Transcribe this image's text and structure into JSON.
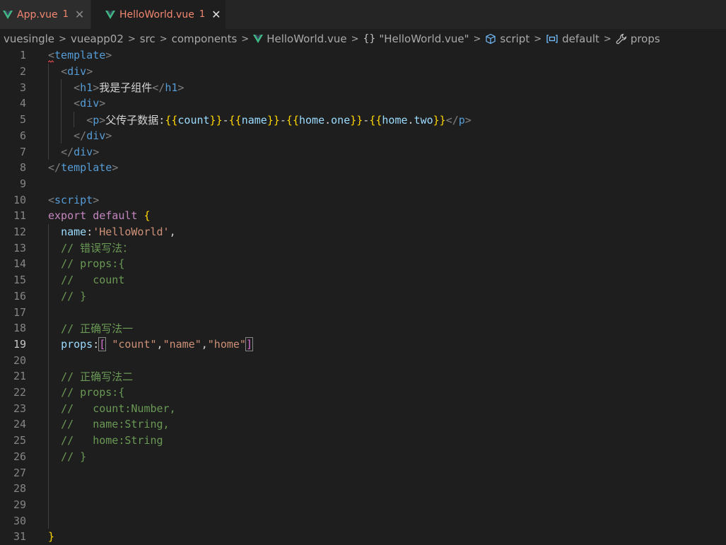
{
  "tabs": [
    {
      "label": "App.vue",
      "badge": "1",
      "close": "✕"
    },
    {
      "label": "HelloWorld.vue",
      "badge": "1",
      "close": "✕"
    }
  ],
  "breadcrumb": {
    "items": [
      "vuesingle",
      "vueapp02",
      "src",
      "components",
      "HelloWorld.vue",
      "\"HelloWorld.vue\"",
      "script",
      "default",
      "props"
    ],
    "separator": ">",
    "brace_icon": "{}"
  },
  "editor": {
    "active_line": 19,
    "lines": [
      "<template>",
      "  <div>",
      "    <h1>我是子组件</h1>",
      "    <div>",
      "      <p>父传子数据:{{count}}-{{name}}-{{home.one}}-{{home.two}}</p>",
      "    </div>",
      "  </div>",
      "</template>",
      "",
      "<script>",
      "export default {",
      "  name:'HelloWorld',",
      "  // 错误写法：",
      "  // props:{",
      "  //   count",
      "  // }",
      "",
      "  // 正确写法一",
      "  props:[ \"count\",\"name\",\"home\"]",
      "",
      "  // 正确写法二",
      "  // props:{",
      "  //   count:Number,",
      "  //   name:String,",
      "  //   home:String",
      "  // }",
      "",
      "",
      "",
      "",
      "}"
    ]
  },
  "icons": {
    "vue": "vue-logo-icon",
    "close": "close-icon",
    "cube": "cube-icon",
    "variable": "variable-icon",
    "wrench": "wrench-icon"
  },
  "colors": {
    "background": "#1e1e1e",
    "tab_bar": "#252526",
    "error_text": "#f48771",
    "vue_green": "#41b883"
  }
}
